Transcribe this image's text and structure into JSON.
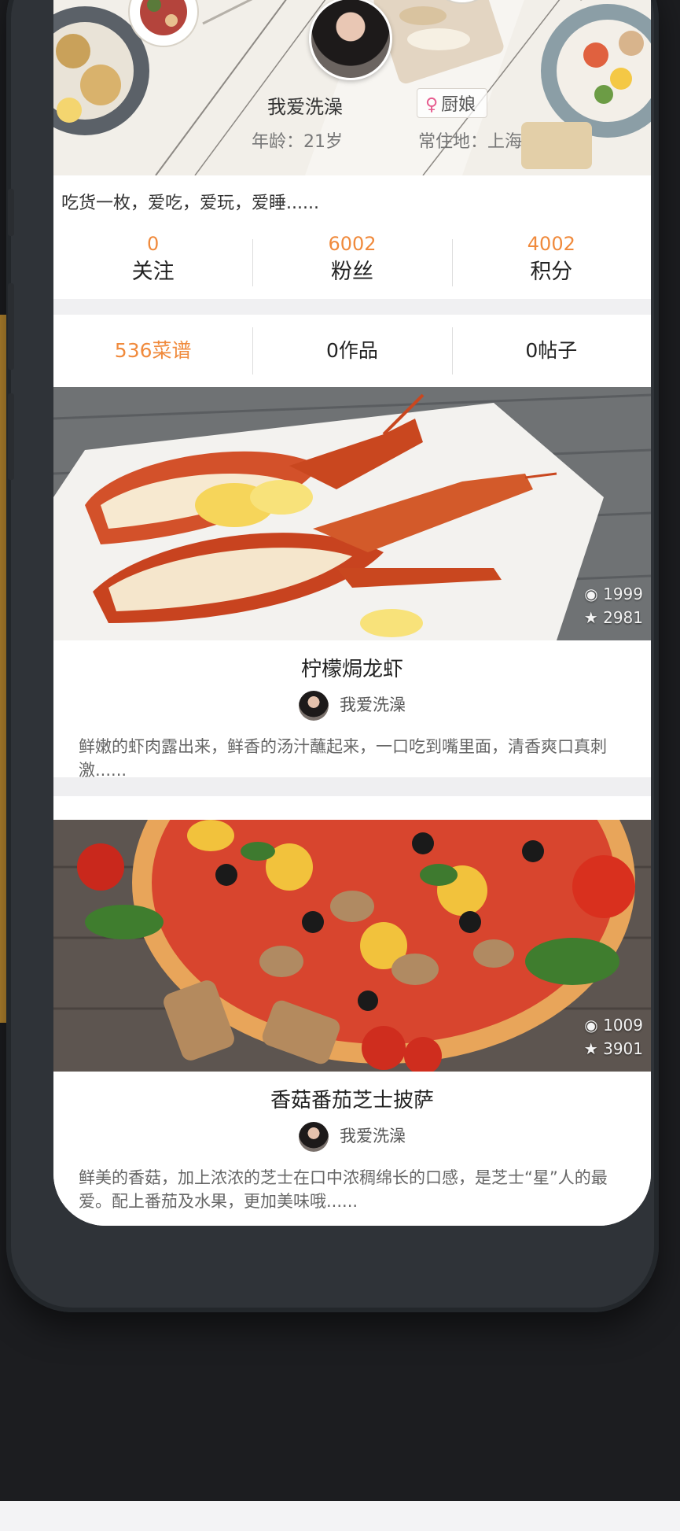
{
  "profile": {
    "username": "我爱洗澡",
    "role_badge": "厨娘",
    "age": "年龄：21岁",
    "residence": "常住地：上海",
    "bio": "吃货一枚，爱吃，爱玩，爱睡......"
  },
  "stats": [
    {
      "value": "0",
      "label": "关注"
    },
    {
      "value": "6002",
      "label": "粉丝"
    },
    {
      "value": "4002",
      "label": "积分"
    }
  ],
  "tabs": [
    {
      "label": "536菜谱",
      "active": true
    },
    {
      "label": "0作品",
      "active": false
    },
    {
      "label": "0帖子",
      "active": false
    }
  ],
  "recipes": [
    {
      "title": "柠檬焗龙虾",
      "views": "1999",
      "favorites": "2981",
      "author": "我爱洗澡",
      "description": "鲜嫩的虾肉露出来，鲜香的汤汁蘸起来，一口吃到嘴里面，清香爽口真刺激......"
    },
    {
      "title": "香菇番茄芝士披萨",
      "views": "1009",
      "favorites": "3901",
      "author": "我爱洗澡",
      "description": "鲜美的香菇，加上浓浓的芝士在口中浓稠绵长的口感，是芝士“星”人的最爱。配上番茄及水果，更加美味哦......"
    }
  ],
  "colors": {
    "accent": "#f08a3c",
    "text": "#222222",
    "phone_frame": "#2f3338",
    "background": "#1c1d20"
  },
  "icons": [
    "female-icon",
    "eye-icon",
    "star-icon"
  ]
}
